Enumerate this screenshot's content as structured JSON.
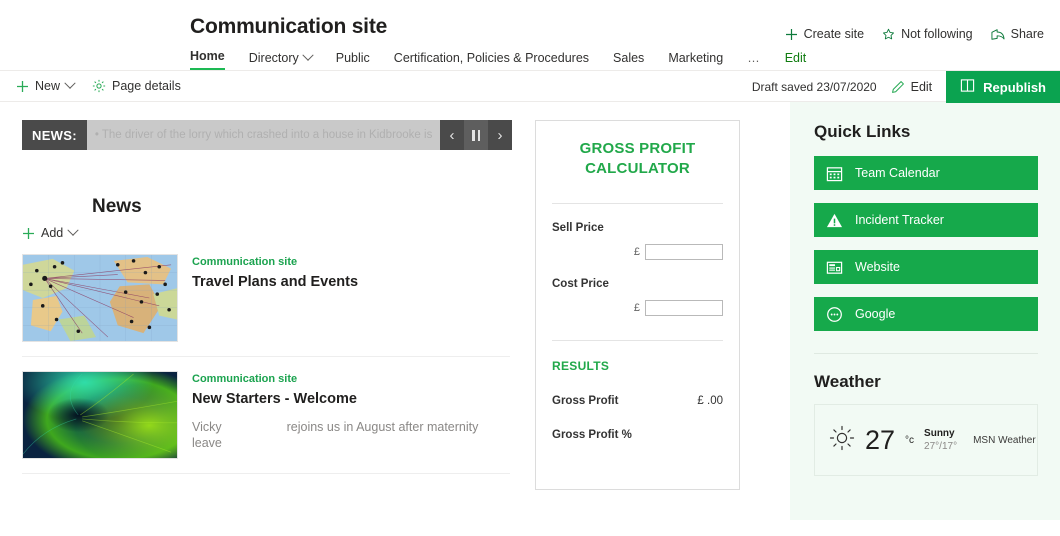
{
  "site": {
    "title": "Communication site",
    "nav": [
      {
        "label": "Home",
        "active": true,
        "dropdown": false
      },
      {
        "label": "Directory",
        "active": false,
        "dropdown": true
      },
      {
        "label": "Public",
        "active": false,
        "dropdown": false
      },
      {
        "label": "Certification, Policies & Procedures",
        "active": false,
        "dropdown": false
      },
      {
        "label": "Sales",
        "active": false,
        "dropdown": false
      },
      {
        "label": "Marketing",
        "active": false,
        "dropdown": false
      },
      {
        "label": "…",
        "active": false,
        "dropdown": false
      },
      {
        "label": "Edit",
        "active": false,
        "dropdown": false
      }
    ],
    "actions": [
      {
        "label": "Create site",
        "icon": "plus-icon"
      },
      {
        "label": "Not following",
        "icon": "star-icon"
      },
      {
        "label": "Share",
        "icon": "share-icon"
      }
    ]
  },
  "commandbar": {
    "new_label": "New",
    "page_details_label": "Page details",
    "draft_status": "Draft saved 23/07/2020",
    "edit_label": "Edit",
    "republish_label": "Republish"
  },
  "ticker": {
    "label": "NEWS:",
    "text": "• The driver of the lorry which crashed into a house in Kidbrooke is",
    "prev": "‹",
    "next": "›",
    "pause": "pause"
  },
  "news": {
    "heading": "News",
    "add_label": "Add",
    "articles": [
      {
        "site": "Communication site",
        "title": "Travel Plans and Events",
        "description": "",
        "description_redacted": true,
        "thumbnail": "world-map-routes"
      },
      {
        "site": "Communication site",
        "title": "New Starters - Welcome",
        "description_prefix": "Vicky",
        "description_suffix": "rejoins us in August after maternity leave",
        "description_redacted": false,
        "thumbnail": "green-abstract-aurora"
      }
    ]
  },
  "calculator": {
    "title": "GROSS PROFIT CALCULATOR",
    "fields": [
      {
        "label": "Sell Price",
        "currency": "£",
        "value": "",
        "placeholder": ""
      },
      {
        "label": "Cost Price",
        "currency": "£",
        "value": "",
        "placeholder": ""
      }
    ],
    "results_title": "RESULTS",
    "results": [
      {
        "label": "Gross Profit",
        "value": "£ .00"
      },
      {
        "label": "Gross Profit %",
        "value": ""
      }
    ]
  },
  "quick_links": {
    "heading": "Quick Links",
    "items": [
      {
        "label": "Team Calendar",
        "icon": "calendar-icon"
      },
      {
        "label": "Incident Tracker",
        "icon": "warning-triangle-icon"
      },
      {
        "label": "Website",
        "icon": "webpage-icon"
      },
      {
        "label": "Google",
        "icon": "ellipsis-circle-icon"
      }
    ]
  },
  "weather": {
    "heading": "Weather",
    "temperature": "27",
    "unit": "°c",
    "condition": "Sunny",
    "range": "27°/17°",
    "source": "MSN Weather",
    "icon": "sun-icon"
  },
  "colors": {
    "accent_green": "#0ba350",
    "link_green": "#16a94b",
    "rail_background": "#f2faf4",
    "ticker_dark": "#4a4a4a"
  }
}
